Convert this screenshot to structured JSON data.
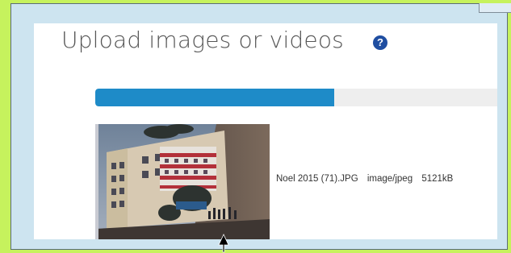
{
  "upload": {
    "title": "Upload images or videos",
    "help_icon": "question-circle-icon",
    "progress_fraction": 0.58
  },
  "file": {
    "name": "Noel 2015 (71).JPG",
    "type": "image/jpeg",
    "size": "5121kB"
  },
  "colors": {
    "page_bg": "#c6f25d",
    "frame_bg": "#cde4f0",
    "progress_fill": "#1e8bc8",
    "help_icon": "#1f4ea1"
  }
}
